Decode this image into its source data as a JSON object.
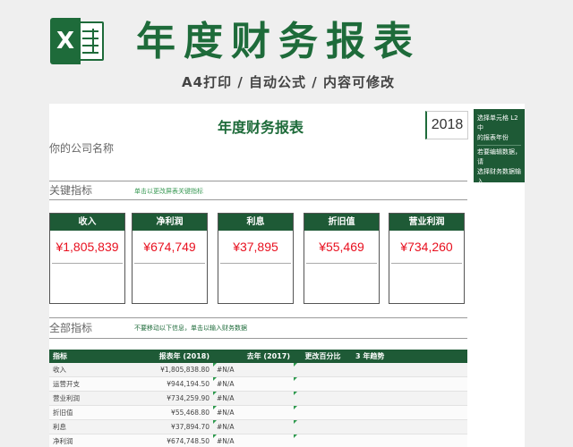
{
  "banner": {
    "logo_letter": "X",
    "title": "年度财务报表",
    "subtitle": "A4打印 / 自动公式 / 内容可修改"
  },
  "sheet": {
    "title": "年度财务报表",
    "company": "你的公司名称",
    "year": "2018",
    "key_section": {
      "label": "关键指标",
      "hint": "单击以更改屏表关键指标"
    },
    "kpis": [
      {
        "label": "收入",
        "value": "¥1,805,839"
      },
      {
        "label": "净利润",
        "value": "¥674,749"
      },
      {
        "label": "利息",
        "value": "¥37,895"
      },
      {
        "label": "折旧值",
        "value": "¥55,469"
      },
      {
        "label": "营业利润",
        "value": "¥734,260"
      }
    ],
    "all_section": {
      "label": "全部指标",
      "hint": "不要移动以下信息，单击以输入财务数据"
    },
    "table": {
      "headers": [
        "指标",
        "报表年 (2018)",
        "去年 (2017)",
        "更改百分比",
        "3 年趋势"
      ],
      "rows": [
        [
          "收入",
          "¥1,805,838.80",
          "#N/A"
        ],
        [
          "运营开支",
          "¥944,194.50",
          "#N/A"
        ],
        [
          "营业利润",
          "¥734,259.90",
          "#N/A"
        ],
        [
          "折旧值",
          "¥55,468.80",
          "#N/A"
        ],
        [
          "利息",
          "¥37,894.70",
          "#N/A"
        ],
        [
          "净利润",
          "¥674,748.50",
          "#N/A"
        ]
      ]
    }
  },
  "notes": {
    "lines": [
      "选择单元格 L2 中",
      "的报表年份",
      "若要编辑数据，请",
      "选择财务数据输入",
      "工作表"
    ]
  }
}
